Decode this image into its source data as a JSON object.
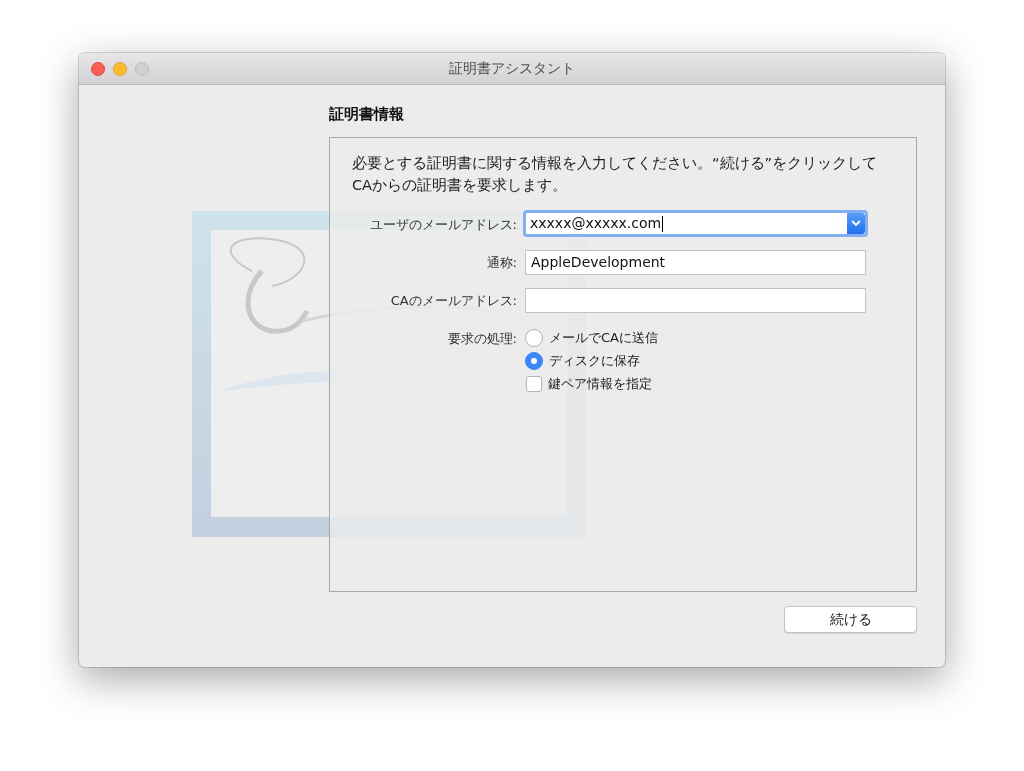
{
  "window": {
    "title": "証明書アシスタント"
  },
  "heading": "証明書情報",
  "intro": "必要とする証明書に関する情報を入力してください。“続ける”をクリックしてCAからの証明書を要求します。",
  "fields": [
    {
      "kind": "combo",
      "label": "ユーザのメールアドレス:",
      "value": "xxxxx@xxxxx.com",
      "focused": true
    },
    {
      "kind": "text",
      "label": "通称:",
      "value": "AppleDevelopment",
      "focused": false
    },
    {
      "kind": "text",
      "label": "CAのメールアドレス:",
      "focused": false
    }
  ],
  "request": {
    "label": "要求の処理:",
    "options": [
      {
        "label": "メールでCAに送信",
        "selected": false
      },
      {
        "label": "ディスクに保存",
        "selected": true
      }
    ]
  },
  "key_pair": {
    "label": "鍵ペア情報を指定",
    "checked": false
  },
  "buttons": [
    "続ける"
  ]
}
